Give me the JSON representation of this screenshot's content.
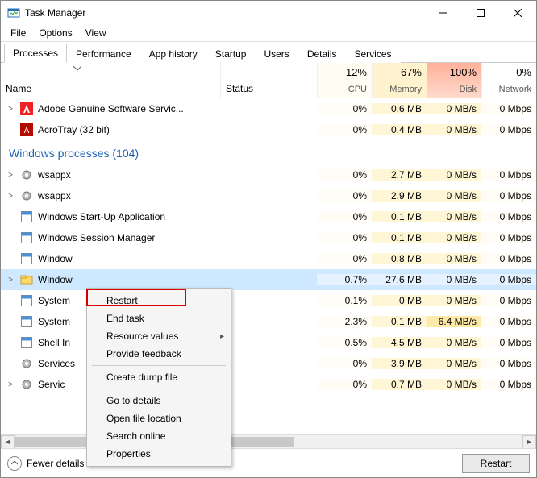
{
  "window": {
    "title": "Task Manager"
  },
  "menu": {
    "file": "File",
    "options": "Options",
    "view": "View"
  },
  "tabs": {
    "processes": "Processes",
    "performance": "Performance",
    "app_history": "App history",
    "startup": "Startup",
    "users": "Users",
    "details": "Details",
    "services": "Services"
  },
  "columns": {
    "name": "Name",
    "status": "Status",
    "cpu": {
      "pct": "12%",
      "label": "CPU"
    },
    "memory": {
      "pct": "67%",
      "label": "Memory"
    },
    "disk": {
      "pct": "100%",
      "label": "Disk"
    },
    "network": {
      "pct": "0%",
      "label": "Network"
    }
  },
  "group_header": "Windows processes (104)",
  "rows": [
    {
      "expand": true,
      "name": "Adobe Genuine Software Servic...",
      "cpu": "0%",
      "mem": "0.6 MB",
      "disk": "0 MB/s",
      "net": "0 Mbps",
      "icon": "adobe"
    },
    {
      "expand": false,
      "name": "AcroTray (32 bit)",
      "cpu": "0%",
      "mem": "0.4 MB",
      "disk": "0 MB/s",
      "net": "0 Mbps",
      "icon": "acro"
    },
    {
      "group": true
    },
    {
      "expand": true,
      "name": "wsappx",
      "cpu": "0%",
      "mem": "2.7 MB",
      "disk": "0 MB/s",
      "net": "0 Mbps",
      "icon": "gear"
    },
    {
      "expand": true,
      "name": "wsappx",
      "cpu": "0%",
      "mem": "2.9 MB",
      "disk": "0 MB/s",
      "net": "0 Mbps",
      "icon": "gear"
    },
    {
      "expand": false,
      "name": "Windows Start-Up Application",
      "cpu": "0%",
      "mem": "0.1 MB",
      "disk": "0 MB/s",
      "net": "0 Mbps",
      "icon": "box"
    },
    {
      "expand": false,
      "name": "Windows Session Manager",
      "cpu": "0%",
      "mem": "0.1 MB",
      "disk": "0 MB/s",
      "net": "0 Mbps",
      "icon": "box"
    },
    {
      "expand": false,
      "name": "Window",
      "cpu": "0%",
      "mem": "0.8 MB",
      "disk": "0 MB/s",
      "net": "0 Mbps",
      "icon": "box"
    },
    {
      "expand": true,
      "name": "Window",
      "selected": true,
      "cpu": "0.7%",
      "mem": "27.6 MB",
      "disk": "0 MB/s",
      "net": "0 Mbps",
      "icon": "explorer"
    },
    {
      "expand": false,
      "name": "System",
      "cpu": "0.1%",
      "mem": "0 MB",
      "disk": "0 MB/s",
      "net": "0 Mbps",
      "icon": "box"
    },
    {
      "expand": false,
      "name": "System",
      "cpu": "2.3%",
      "mem": "0.1 MB",
      "disk": "6.4 MB/s",
      "net": "0 Mbps",
      "icon": "box"
    },
    {
      "expand": false,
      "name": "Shell In",
      "cpu": "0.5%",
      "mem": "4.5 MB",
      "disk": "0 MB/s",
      "net": "0 Mbps",
      "icon": "box"
    },
    {
      "expand": false,
      "name": "Services",
      "cpu": "0%",
      "mem": "3.9 MB",
      "disk": "0 MB/s",
      "net": "0 Mbps",
      "icon": "gear"
    },
    {
      "expand": true,
      "name": "Servic",
      "cpu": "0%",
      "mem": "0.7 MB",
      "disk": "0 MB/s",
      "net": "0 Mbps",
      "icon": "gear"
    }
  ],
  "context_menu": {
    "restart": "Restart",
    "end_task": "End task",
    "resource_values": "Resource values",
    "provide_feedback": "Provide feedback",
    "create_dump": "Create dump file",
    "go_to_details": "Go to details",
    "open_file_location": "Open file location",
    "search_online": "Search online",
    "properties": "Properties"
  },
  "footer": {
    "fewer_details": "Fewer details",
    "restart_button": "Restart"
  }
}
